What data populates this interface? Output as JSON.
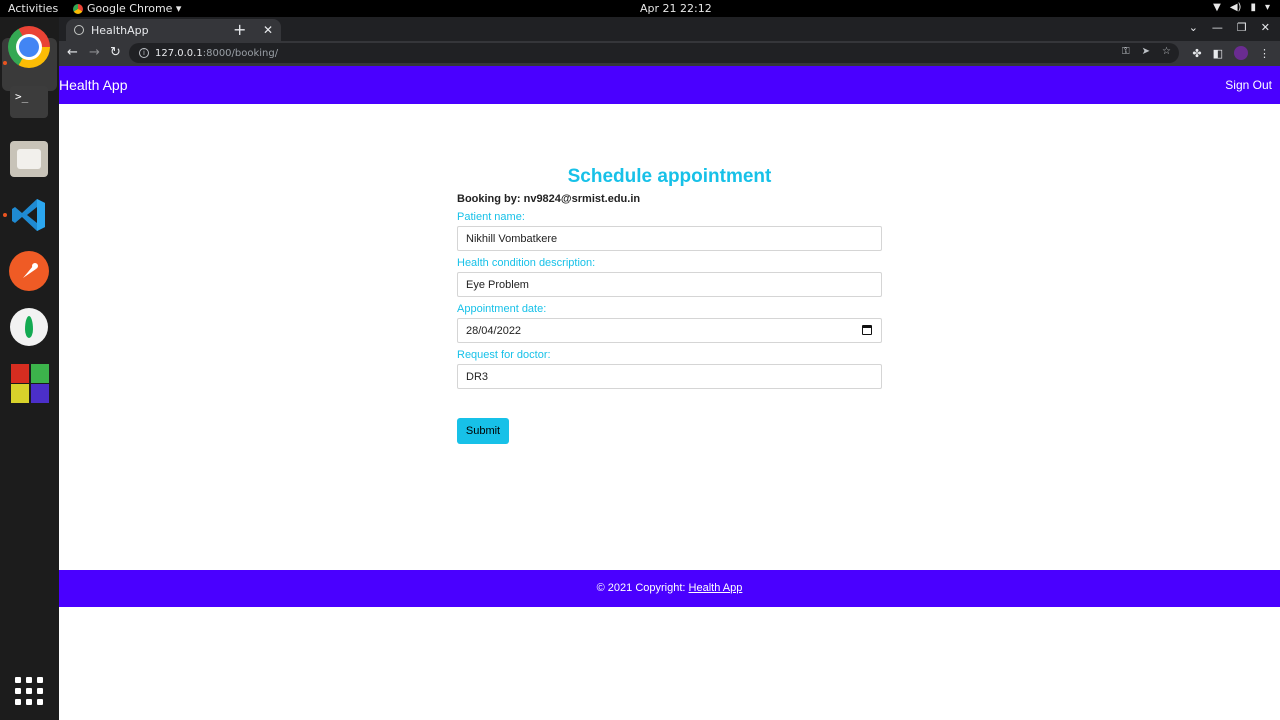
{
  "topbar": {
    "activities": "Activities",
    "app_menu": "Google Chrome ▾",
    "clock": "Apr 21  22:12"
  },
  "dock": {
    "items": [
      "chrome-icon",
      "terminal-icon",
      "files-icon",
      "vscode-icon",
      "postman-icon",
      "mongodb-compass-icon",
      "blocks-app-icon",
      "show-apps-icon"
    ],
    "terminal_glyph": ">_"
  },
  "browser": {
    "tab_title": "HealthApp",
    "url_host": "127.0.0.1",
    "url_rest": ":8000/booking/"
  },
  "app": {
    "brand": "Health App",
    "signout": "Sign Out",
    "accent": "#4a00ff",
    "highlight": "#17c1e8"
  },
  "form": {
    "title": "Schedule appointment",
    "booking_by": "Booking by: nv9824@srmist.edu.in",
    "patient_label": "Patient name:",
    "patient_value": "Nikhill Vombatkere",
    "condition_label": "Health condition description:",
    "condition_value": "Eye Problem",
    "date_label": "Appointment date:",
    "date_value": "28/04/2022",
    "doctor_label": "Request for doctor:",
    "doctor_value": "DR3",
    "submit": "Submit"
  },
  "footer": {
    "text": "© 2021 Copyright: ",
    "link": "Health App"
  }
}
